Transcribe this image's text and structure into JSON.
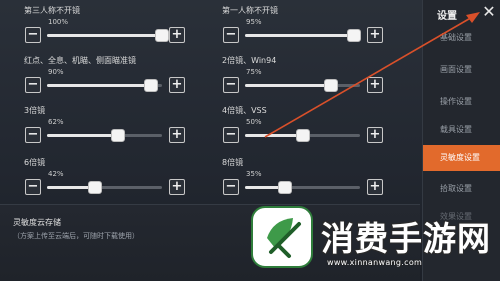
{
  "colors": {
    "accent": "#e26a2c",
    "arrow": "#d9502a",
    "logo_green": "#2f7d3b"
  },
  "sliders": [
    {
      "label": "第三人称不开镜",
      "percent": "100%",
      "value": 100
    },
    {
      "label": "第一人称不开镜",
      "percent": "95%",
      "value": 95
    },
    {
      "label": "红点、全息、机瞄、侧面瞄准镜",
      "percent": "90%",
      "value": 90
    },
    {
      "label": "2倍镜、Win94",
      "percent": "75%",
      "value": 75
    },
    {
      "label": "3倍镜",
      "percent": "62%",
      "value": 62
    },
    {
      "label": "4倍镜、VSS",
      "percent": "50%",
      "value": 50
    },
    {
      "label": "6倍镜",
      "percent": "42%",
      "value": 42
    },
    {
      "label": "8倍镜",
      "percent": "35%",
      "value": 35
    }
  ],
  "buttons": {
    "minus": "−",
    "plus": "+"
  },
  "cloud": {
    "title": "灵敏度云存储",
    "desc": "（方案上传至云端后，可随时下载使用）"
  },
  "nav": {
    "title": "设置",
    "close": "✕",
    "items": [
      "基础设置",
      "画面设置",
      "操作设置",
      "载具设置",
      "灵敏度设置",
      "拾取设置",
      "效果设置"
    ],
    "active_index": 4
  },
  "watermark": {
    "icon": "leaf-check-logo",
    "name": "消费手游网",
    "url": "www.xinnanwang.com"
  }
}
